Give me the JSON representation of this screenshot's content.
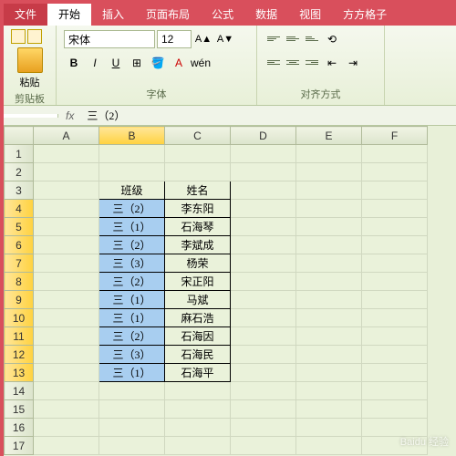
{
  "tabs": {
    "file": "文件",
    "home": "开始",
    "insert": "插入",
    "layout": "页面布局",
    "formula": "公式",
    "data": "数据",
    "view": "视图",
    "fangfang": "方方格子"
  },
  "ribbon": {
    "clipboard_label": "剪贴板",
    "paste_label": "粘贴",
    "font_label": "字体",
    "font_name": "宋体",
    "font_size": "12",
    "bold": "B",
    "italic": "I",
    "underline": "U",
    "align_label": "对齐方式"
  },
  "formula_bar": {
    "fx": "fx",
    "value": "三（2）"
  },
  "columns": [
    "A",
    "B",
    "C",
    "D",
    "E",
    "F"
  ],
  "chart_data": {
    "type": "table",
    "header": {
      "b": "班级",
      "c": "姓名"
    },
    "rows": [
      {
        "b": "三（2）",
        "c": "李东阳"
      },
      {
        "b": "三（1）",
        "c": "石海琴"
      },
      {
        "b": "三（2）",
        "c": "李斌成"
      },
      {
        "b": "三（3）",
        "c": "杨荣"
      },
      {
        "b": "三（2）",
        "c": "宋正阳"
      },
      {
        "b": "三（1）",
        "c": "马斌"
      },
      {
        "b": "三（1）",
        "c": "麻石浩"
      },
      {
        "b": "三（2）",
        "c": "石海因"
      },
      {
        "b": "三（3）",
        "c": "石海民"
      },
      {
        "b": "三（1）",
        "c": "石海平"
      }
    ]
  },
  "watermark": "Baidu 经验"
}
